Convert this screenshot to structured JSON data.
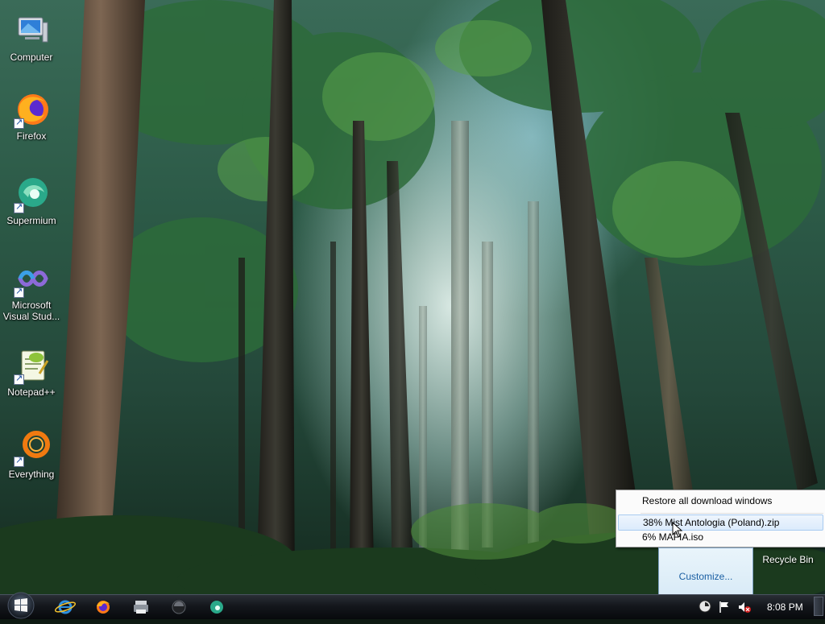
{
  "desktop": {
    "icons": [
      {
        "label": "Computer",
        "icon": "computer-icon"
      },
      {
        "label": "Firefox",
        "icon": "firefox-icon"
      },
      {
        "label": "Supermium",
        "icon": "supermium-icon"
      },
      {
        "label": "Microsoft Visual Stud...",
        "icon": "visual-studio-icon"
      },
      {
        "label": "Notepad++",
        "icon": "notepad-plus-plus-icon"
      },
      {
        "label": "Everything",
        "icon": "everything-icon"
      }
    ],
    "recycle_bin_label": "Recycle Bin"
  },
  "download_menu": {
    "items": [
      {
        "label": "Restore all download windows"
      },
      {
        "label": "38% Mist Antologia (Poland).zip",
        "highlighted": true
      },
      {
        "label": "6% MAFIA.iso"
      }
    ]
  },
  "tray_popup": {
    "customize_label": "Customize..."
  },
  "taskbar": {
    "pinned": [
      {
        "name": "internet-explorer-icon"
      },
      {
        "name": "firefox-icon"
      },
      {
        "name": "printer-icon"
      },
      {
        "name": "media-player-icon"
      },
      {
        "name": "supermium-icon"
      }
    ],
    "clock": "8:08 PM"
  },
  "colors": {
    "taskbar": "#0b0e12",
    "menu_highlight": "#dcebfc",
    "link_blue": "#1b5fa3"
  }
}
